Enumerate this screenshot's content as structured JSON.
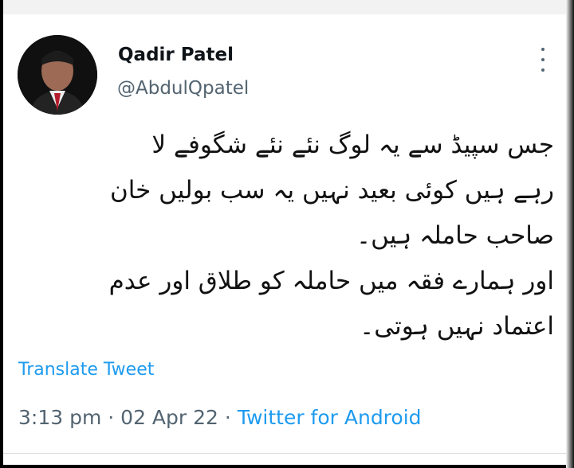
{
  "author": {
    "name": "Qadir Patel",
    "handle": "@AbdulQpatel"
  },
  "tweet": {
    "lines": [
      "جس سپیڈ سے یہ لوگ نئے نئے شگوفے لا",
      "رہے ہیں کوئی بعید نہیں یہ سب بولیں خان",
      "صاحب حاملہ ہیں۔",
      "اور ہمارے فقہ میں حاملہ کو طلاق اور عدم",
      "اعتماد نہیں ہوتی۔"
    ]
  },
  "translate_label": "Translate Tweet",
  "meta": {
    "time": "3:13 pm",
    "date": "02 Apr 22",
    "source": "Twitter for Android"
  },
  "colors": {
    "link": "#1d9bf0",
    "secondary": "#536471",
    "text": "#0f1419"
  },
  "icons": [
    "more-options-icon"
  ]
}
